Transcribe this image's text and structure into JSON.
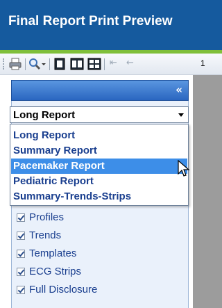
{
  "window": {
    "title": "Final Report Print Preview"
  },
  "toolbar": {
    "page_number": "1",
    "icons": [
      "print-icon",
      "zoom-icon",
      "single-page-icon",
      "two-page-icon",
      "multi-page-icon",
      "first-page-icon",
      "previous-page-icon"
    ]
  },
  "panel": {
    "collapse_glyph": "«",
    "report_select": {
      "value": "Long Report"
    },
    "options": [
      {
        "label": "Long Report"
      },
      {
        "label": "Summary Report"
      },
      {
        "label": "Pacemaker Report"
      },
      {
        "label": "Pediatric Report"
      },
      {
        "label": "Summary-Trends-Strips"
      }
    ],
    "selected_option_index": 2,
    "checkboxes": [
      {
        "label": "Profiles",
        "checked": true
      },
      {
        "label": "Trends",
        "checked": true
      },
      {
        "label": "Templates",
        "checked": true
      },
      {
        "label": "ECG Strips",
        "checked": true
      },
      {
        "label": "Full Disclosure",
        "checked": true
      }
    ]
  },
  "colors": {
    "title_bar": "#155a9e",
    "accent_green": "#7fbf3a",
    "highlight": "#3d8ee8",
    "link_text": "#1a3f8f"
  }
}
